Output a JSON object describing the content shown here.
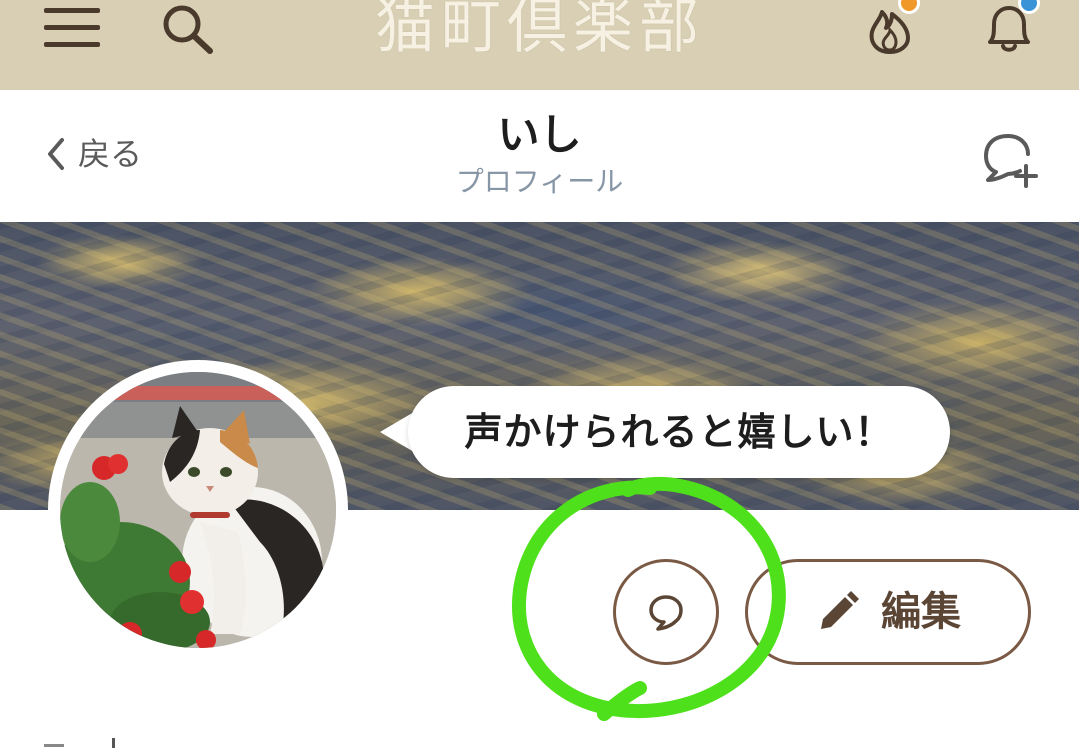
{
  "topbar": {
    "logo_text": "猫町倶楽部",
    "icons": [
      "menu-icon",
      "search-icon",
      "fire-icon",
      "bell-icon"
    ],
    "badge_colors": {
      "fire": "#f0982a",
      "bell": "#3a93d6"
    },
    "background": "#d8cfb4"
  },
  "header": {
    "back_label": "戻る",
    "title": "いし",
    "subtitle": "プロフィール",
    "right_icon": "add-chat-icon"
  },
  "profile": {
    "status_message": "声かけられると嬉しい！",
    "avatar": "calico-cat-with-red-flowers",
    "cover": "golden-clouds-sky"
  },
  "actions": {
    "chat_icon": "speech-bubble-icon",
    "edit_label": "編集",
    "edit_icon": "pencil-icon",
    "accent": "#7a5a44"
  },
  "annotation": {
    "shape": "hand-drawn-circle",
    "color": "#4fe01c",
    "target": "chat-button"
  }
}
